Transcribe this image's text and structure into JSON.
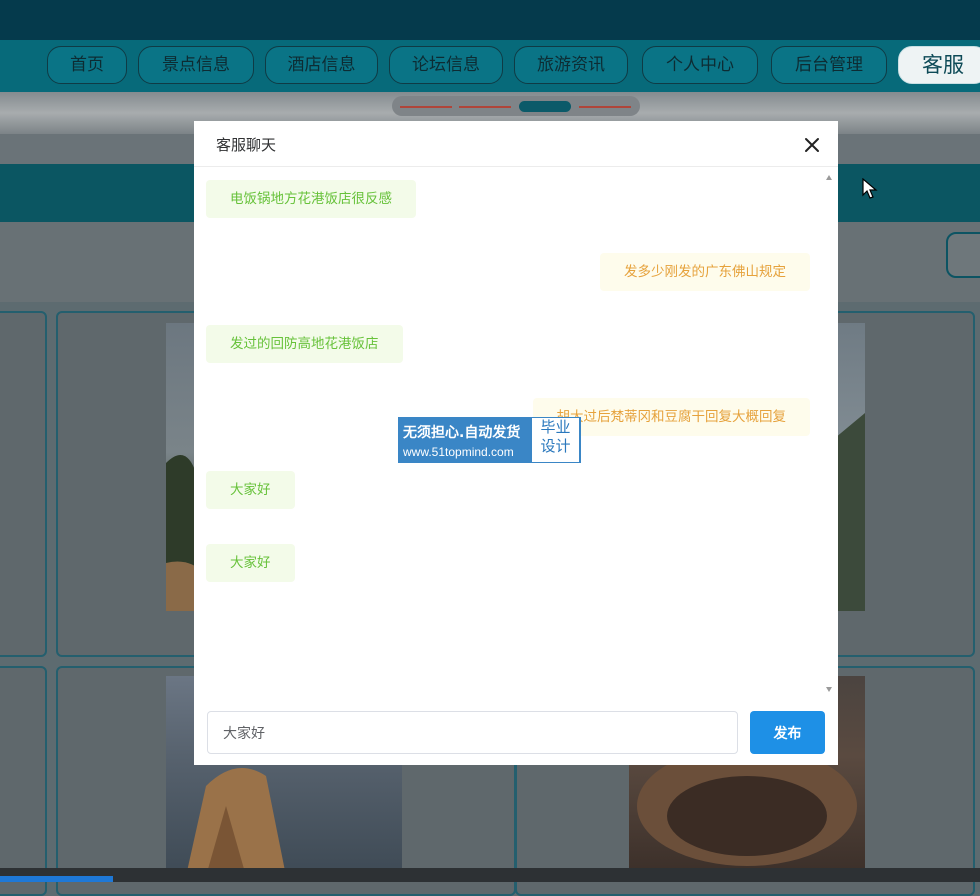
{
  "nav": {
    "items": [
      {
        "label": "首页"
      },
      {
        "label": "景点信息"
      },
      {
        "label": "酒店信息"
      },
      {
        "label": "论坛信息"
      },
      {
        "label": "旅游资讯"
      },
      {
        "label": "个人中心"
      },
      {
        "label": "后台管理"
      },
      {
        "label": "客服"
      }
    ],
    "active_index": 7
  },
  "dialog": {
    "title": "客服聊天",
    "close_icon": "close-icon",
    "messages": [
      {
        "side": "left",
        "text": "电饭锅地方花港饭店很反感"
      },
      {
        "side": "right",
        "text": "发多少刚发的广东佛山规定"
      },
      {
        "side": "left",
        "text": "发过的回防高地花港饭店"
      },
      {
        "side": "right",
        "text": "胡大过后梵蒂冈和豆腐干回复大概回复"
      },
      {
        "side": "left",
        "text": "大家好"
      },
      {
        "side": "left",
        "text": "大家好"
      }
    ],
    "input_value": "大家好",
    "submit_label": "发布"
  },
  "watermark": {
    "line1": "无须担心.自动发货",
    "line2": "www.51topmind.com",
    "badge_line1": "毕业",
    "badge_line2": "设计"
  },
  "colors": {
    "nav_bg": "#076a7a",
    "top_bg": "#053a4c",
    "left_bubble_text": "#67c23a",
    "right_bubble_text": "#e6a23c",
    "primary_button": "#1e90e6"
  }
}
